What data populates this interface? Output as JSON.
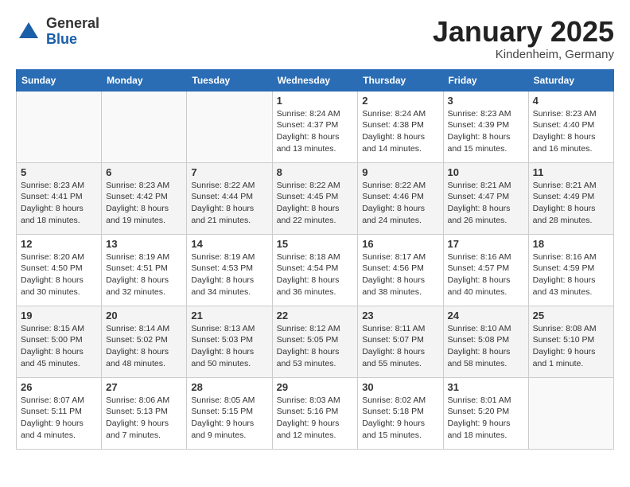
{
  "header": {
    "logo_general": "General",
    "logo_blue": "Blue",
    "month_title": "January 2025",
    "location": "Kindenheim, Germany"
  },
  "weekdays": [
    "Sunday",
    "Monday",
    "Tuesday",
    "Wednesday",
    "Thursday",
    "Friday",
    "Saturday"
  ],
  "weeks": [
    [
      {
        "day": "",
        "empty": true
      },
      {
        "day": "",
        "empty": true
      },
      {
        "day": "",
        "empty": true
      },
      {
        "day": "1",
        "sunrise": "Sunrise: 8:24 AM",
        "sunset": "Sunset: 4:37 PM",
        "daylight": "Daylight: 8 hours and 13 minutes."
      },
      {
        "day": "2",
        "sunrise": "Sunrise: 8:24 AM",
        "sunset": "Sunset: 4:38 PM",
        "daylight": "Daylight: 8 hours and 14 minutes."
      },
      {
        "day": "3",
        "sunrise": "Sunrise: 8:23 AM",
        "sunset": "Sunset: 4:39 PM",
        "daylight": "Daylight: 8 hours and 15 minutes."
      },
      {
        "day": "4",
        "sunrise": "Sunrise: 8:23 AM",
        "sunset": "Sunset: 4:40 PM",
        "daylight": "Daylight: 8 hours and 16 minutes."
      }
    ],
    [
      {
        "day": "5",
        "sunrise": "Sunrise: 8:23 AM",
        "sunset": "Sunset: 4:41 PM",
        "daylight": "Daylight: 8 hours and 18 minutes."
      },
      {
        "day": "6",
        "sunrise": "Sunrise: 8:23 AM",
        "sunset": "Sunset: 4:42 PM",
        "daylight": "Daylight: 8 hours and 19 minutes."
      },
      {
        "day": "7",
        "sunrise": "Sunrise: 8:22 AM",
        "sunset": "Sunset: 4:44 PM",
        "daylight": "Daylight: 8 hours and 21 minutes."
      },
      {
        "day": "8",
        "sunrise": "Sunrise: 8:22 AM",
        "sunset": "Sunset: 4:45 PM",
        "daylight": "Daylight: 8 hours and 22 minutes."
      },
      {
        "day": "9",
        "sunrise": "Sunrise: 8:22 AM",
        "sunset": "Sunset: 4:46 PM",
        "daylight": "Daylight: 8 hours and 24 minutes."
      },
      {
        "day": "10",
        "sunrise": "Sunrise: 8:21 AM",
        "sunset": "Sunset: 4:47 PM",
        "daylight": "Daylight: 8 hours and 26 minutes."
      },
      {
        "day": "11",
        "sunrise": "Sunrise: 8:21 AM",
        "sunset": "Sunset: 4:49 PM",
        "daylight": "Daylight: 8 hours and 28 minutes."
      }
    ],
    [
      {
        "day": "12",
        "sunrise": "Sunrise: 8:20 AM",
        "sunset": "Sunset: 4:50 PM",
        "daylight": "Daylight: 8 hours and 30 minutes."
      },
      {
        "day": "13",
        "sunrise": "Sunrise: 8:19 AM",
        "sunset": "Sunset: 4:51 PM",
        "daylight": "Daylight: 8 hours and 32 minutes."
      },
      {
        "day": "14",
        "sunrise": "Sunrise: 8:19 AM",
        "sunset": "Sunset: 4:53 PM",
        "daylight": "Daylight: 8 hours and 34 minutes."
      },
      {
        "day": "15",
        "sunrise": "Sunrise: 8:18 AM",
        "sunset": "Sunset: 4:54 PM",
        "daylight": "Daylight: 8 hours and 36 minutes."
      },
      {
        "day": "16",
        "sunrise": "Sunrise: 8:17 AM",
        "sunset": "Sunset: 4:56 PM",
        "daylight": "Daylight: 8 hours and 38 minutes."
      },
      {
        "day": "17",
        "sunrise": "Sunrise: 8:16 AM",
        "sunset": "Sunset: 4:57 PM",
        "daylight": "Daylight: 8 hours and 40 minutes."
      },
      {
        "day": "18",
        "sunrise": "Sunrise: 8:16 AM",
        "sunset": "Sunset: 4:59 PM",
        "daylight": "Daylight: 8 hours and 43 minutes."
      }
    ],
    [
      {
        "day": "19",
        "sunrise": "Sunrise: 8:15 AM",
        "sunset": "Sunset: 5:00 PM",
        "daylight": "Daylight: 8 hours and 45 minutes."
      },
      {
        "day": "20",
        "sunrise": "Sunrise: 8:14 AM",
        "sunset": "Sunset: 5:02 PM",
        "daylight": "Daylight: 8 hours and 48 minutes."
      },
      {
        "day": "21",
        "sunrise": "Sunrise: 8:13 AM",
        "sunset": "Sunset: 5:03 PM",
        "daylight": "Daylight: 8 hours and 50 minutes."
      },
      {
        "day": "22",
        "sunrise": "Sunrise: 8:12 AM",
        "sunset": "Sunset: 5:05 PM",
        "daylight": "Daylight: 8 hours and 53 minutes."
      },
      {
        "day": "23",
        "sunrise": "Sunrise: 8:11 AM",
        "sunset": "Sunset: 5:07 PM",
        "daylight": "Daylight: 8 hours and 55 minutes."
      },
      {
        "day": "24",
        "sunrise": "Sunrise: 8:10 AM",
        "sunset": "Sunset: 5:08 PM",
        "daylight": "Daylight: 8 hours and 58 minutes."
      },
      {
        "day": "25",
        "sunrise": "Sunrise: 8:08 AM",
        "sunset": "Sunset: 5:10 PM",
        "daylight": "Daylight: 9 hours and 1 minute."
      }
    ],
    [
      {
        "day": "26",
        "sunrise": "Sunrise: 8:07 AM",
        "sunset": "Sunset: 5:11 PM",
        "daylight": "Daylight: 9 hours and 4 minutes."
      },
      {
        "day": "27",
        "sunrise": "Sunrise: 8:06 AM",
        "sunset": "Sunset: 5:13 PM",
        "daylight": "Daylight: 9 hours and 7 minutes."
      },
      {
        "day": "28",
        "sunrise": "Sunrise: 8:05 AM",
        "sunset": "Sunset: 5:15 PM",
        "daylight": "Daylight: 9 hours and 9 minutes."
      },
      {
        "day": "29",
        "sunrise": "Sunrise: 8:03 AM",
        "sunset": "Sunset: 5:16 PM",
        "daylight": "Daylight: 9 hours and 12 minutes."
      },
      {
        "day": "30",
        "sunrise": "Sunrise: 8:02 AM",
        "sunset": "Sunset: 5:18 PM",
        "daylight": "Daylight: 9 hours and 15 minutes."
      },
      {
        "day": "31",
        "sunrise": "Sunrise: 8:01 AM",
        "sunset": "Sunset: 5:20 PM",
        "daylight": "Daylight: 9 hours and 18 minutes."
      },
      {
        "day": "",
        "empty": true
      }
    ]
  ]
}
